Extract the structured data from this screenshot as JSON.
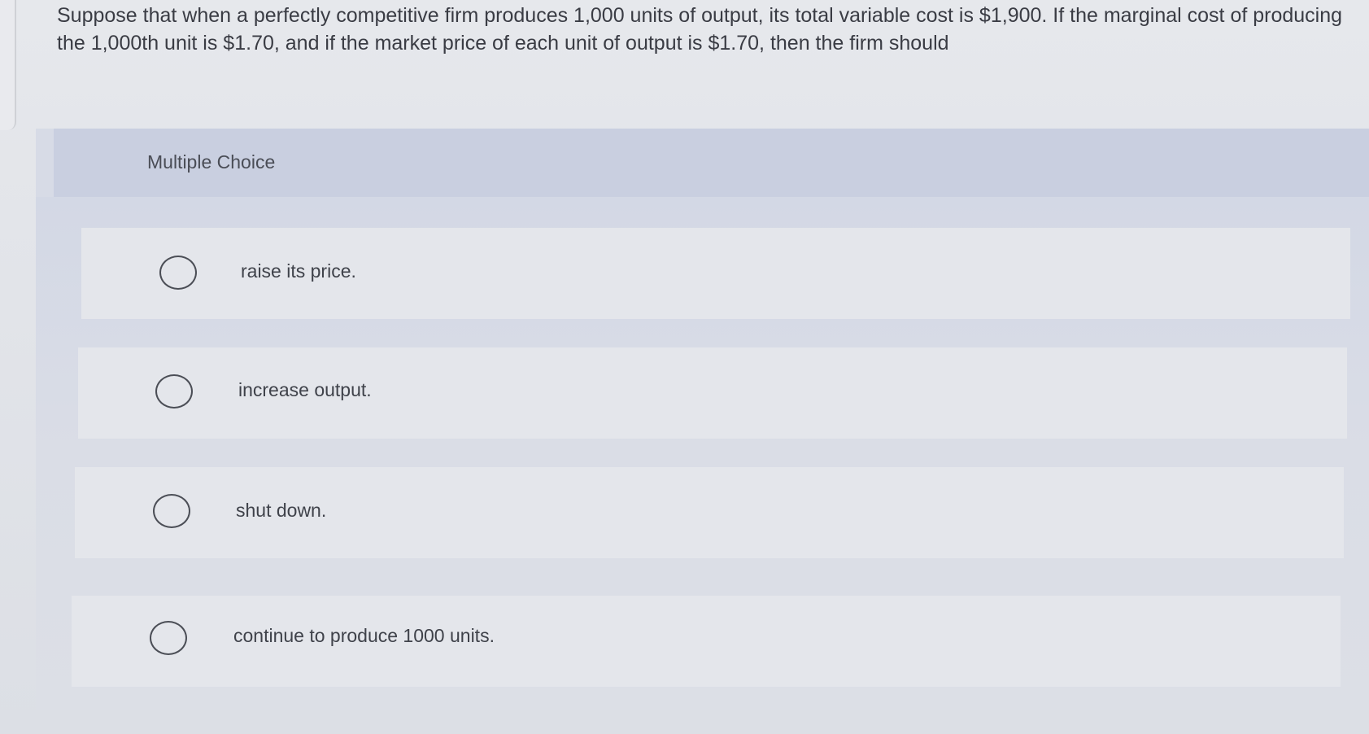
{
  "question": {
    "text": "Suppose that when a perfectly competitive firm produces 1,000 units of output, its total variable cost is $1,900. If the marginal cost of producing the 1,000th unit is $1.70, and if the market price of each unit of output is $1.70, then the firm should"
  },
  "multiple_choice": {
    "title": "Multiple Choice",
    "options": [
      {
        "label": "raise its price.",
        "selected": false
      },
      {
        "label": "increase output.",
        "selected": false
      },
      {
        "label": "shut down.",
        "selected": false
      },
      {
        "label": "continue to produce 1000 units.",
        "selected": false
      }
    ]
  },
  "colors": {
    "header_band": "#c9cfe0",
    "option_background": "#e4e6eb",
    "text": "#3a3c44"
  }
}
